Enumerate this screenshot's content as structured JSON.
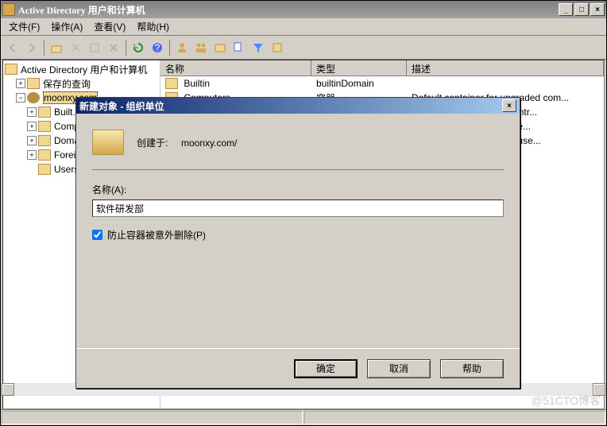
{
  "window": {
    "title": "Active Directory 用户和计算机"
  },
  "menubar": {
    "file": "文件(F)",
    "action": "操作(A)",
    "view": "查看(V)",
    "help": "帮助(H)"
  },
  "tree": {
    "root": "Active Directory 用户和计算机",
    "saved_queries": "保存的查询",
    "domain": "moonxy.com",
    "nodes": [
      "Built…",
      "Compu…",
      "Domai…",
      "Forei…",
      "Users"
    ]
  },
  "list": {
    "headers": {
      "name": "名称",
      "type": "类型",
      "desc": "描述"
    },
    "rows": [
      {
        "name": "Builtin",
        "type": "builtinDomain",
        "desc": ""
      },
      {
        "name": "Computers",
        "type": "容器",
        "desc": "Default container for upgraded com..."
      },
      {
        "name": "",
        "type": "",
        "desc": "lt container for domain contr..."
      },
      {
        "name": "",
        "type": "",
        "desc": "lt container for security ide..."
      },
      {
        "name": "",
        "type": "",
        "desc": "lt container for upgraded use..."
      }
    ]
  },
  "dialog": {
    "title": "新建对象 - 组织单位",
    "created_in_label": "创建于:",
    "created_in_value": "moonxy.com/",
    "name_label": "名称(A):",
    "name_value": "软件研发部",
    "protect_label": "防止容器被意外删除(P)",
    "protect_checked": true,
    "ok": "确定",
    "cancel": "取消",
    "help": "帮助"
  },
  "watermark": "@51CTO博客"
}
